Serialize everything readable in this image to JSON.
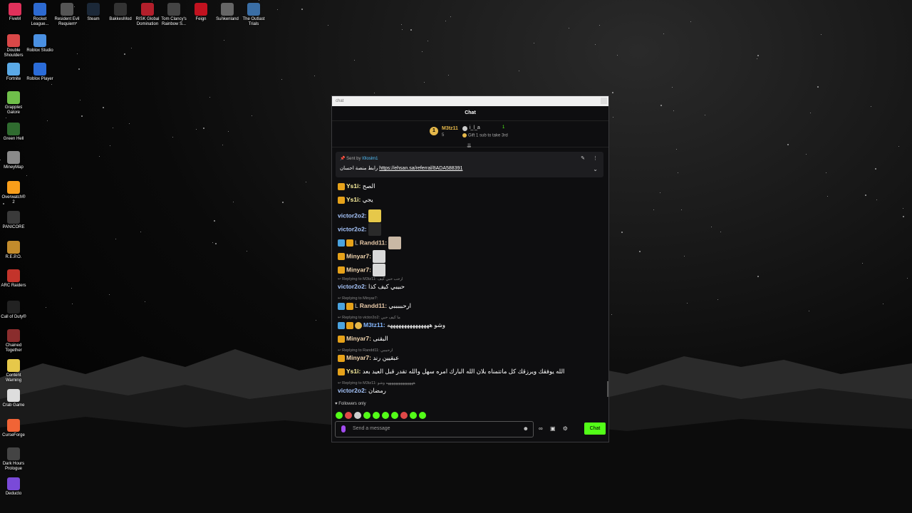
{
  "desktop": {
    "icons": [
      {
        "label": "FiveM",
        "color": "#e0315b"
      },
      {
        "label": "Rocket League...",
        "color": "#2d6ad1"
      },
      {
        "label": "Resident Evil Requiem",
        "color": "#555555"
      },
      {
        "label": "Steam",
        "color": "#1b2838"
      },
      {
        "label": "BakkesMod",
        "color": "#333333"
      },
      {
        "label": "RISK Global Domination",
        "color": "#b21f2b"
      },
      {
        "label": "Tom Clancy's Rainbow S...",
        "color": "#444444"
      },
      {
        "label": "Feign",
        "color": "#c1121f"
      },
      {
        "label": "Sunkenland",
        "color": "#666666"
      },
      {
        "label": "The Outlast Trials",
        "color": "#3a6ea5"
      },
      {
        "label": "Double Shoulders",
        "color": "#d94848"
      },
      {
        "label": "Roblox Studio",
        "color": "#4a90e2"
      },
      {
        "label": "Fortnite",
        "color": "#5aa9e6"
      },
      {
        "label": "Roblox Player",
        "color": "#2b6cd8"
      },
      {
        "label": "Grapples Galore",
        "color": "#6fbf4a"
      },
      {
        "label": "Green Hell",
        "color": "#2f6b2f"
      },
      {
        "label": "MineyMap",
        "color": "#8a8a8a"
      },
      {
        "label": "Overwatch® 2",
        "color": "#f99e1a"
      },
      {
        "label": "PANICORE",
        "color": "#3a3a3a"
      },
      {
        "label": "R.E.P.O.",
        "color": "#c28b2c"
      },
      {
        "label": "ARC Raiders",
        "color": "#c3342b"
      },
      {
        "label": "Call of Duty®",
        "color": "#222222"
      },
      {
        "label": "Chained Together",
        "color": "#8a2d2d"
      },
      {
        "label": "Content Warning",
        "color": "#e6c84a"
      },
      {
        "label": "Crab Game",
        "color": "#dddddd"
      },
      {
        "label": "CurseForge",
        "color": "#f16436"
      },
      {
        "label": "Dark Hours Prologue",
        "color": "#444444"
      },
      {
        "label": "Deducto",
        "color": "#7a4ad8"
      }
    ]
  },
  "window": {
    "title": "chat",
    "header": "Chat"
  },
  "leaderboard": {
    "first_name": "M3tz11",
    "first_count": "5",
    "second_name": "i_l_a",
    "second_count": "1",
    "gift_text": "Gift 1 sub to take 3rd"
  },
  "pinned": {
    "sent_by_label": "Sent by",
    "sent_by_user": "I0loslm1",
    "text_prefix": "رابط منصة احسان",
    "link": "https://ehsan.sa/referral/8ADA588391"
  },
  "messages": [
    {
      "badges": [
        "crown"
      ],
      "user": "Ys1i",
      "color": "#fff3a0",
      "text": "الصح"
    },
    {
      "badges": [
        "crown"
      ],
      "user": "Ys1i",
      "color": "#fff3a0",
      "text": "يجي"
    },
    {
      "badges": [],
      "user": "victor2o2",
      "color": "#a9c8ff",
      "text": "",
      "emote": "#e6c84a"
    },
    {
      "badges": [],
      "user": "victor2o2",
      "color": "#a9c8ff",
      "text": "",
      "emote": "#2a2a2a"
    },
    {
      "badges": [
        "arrow",
        "crown"
      ],
      "prefix": "L",
      "user": "Randd11",
      "color": "#e8c9a8",
      "text": "",
      "emote": "#c9b8a5"
    },
    {
      "badges": [
        "crown"
      ],
      "user": "Minyar7",
      "color": "#f3d7b0",
      "text": "",
      "emote": "#d9d9d9"
    },
    {
      "badges": [
        "crown"
      ],
      "user": "Minyar7",
      "color": "#f3d7b0",
      "text": "",
      "emote": "#d9d9d9"
    },
    {
      "reply": "Replying to M3tz11: ارحب حبي كيف",
      "badges": [],
      "user": "victor2o2",
      "color": "#a9c8ff",
      "text": "حبيبي كيف كذا"
    },
    {
      "reply": "Replying to Minyar7:",
      "badges": [
        "arrow",
        "crown"
      ],
      "prefix": "L",
      "user": "Randd11",
      "color": "#e8c9a8",
      "text": "ارحبببببي"
    },
    {
      "reply": "Replying to victor2o2: ما كيف حبي",
      "badges": [
        "arrow",
        "crown",
        "coin"
      ],
      "user": "M3tz11",
      "color": "#86b8ff",
      "text": "وشو هههههههههههههههه"
    },
    {
      "badges": [
        "crown"
      ],
      "user": "Minyar7",
      "color": "#f3d7b0",
      "text": "البقنى"
    },
    {
      "reply": "Replying to Randd11: ارحبببي",
      "badges": [
        "crown"
      ],
      "user": "Minyar7",
      "color": "#f3d7b0",
      "text": "عبقيين رند"
    },
    {
      "badges": [
        "crown"
      ],
      "user": "Ys1i",
      "color": "#fff3a0",
      "text": "الله يوفقك ويرزقك كل ماتتمناه بلان الله البارك امره سهل والله تقدر قبل العيد بعد"
    },
    {
      "reply": "Replying to M3tz11: هههههههههههههههه وشو",
      "badges": [],
      "user": "victor2o2",
      "color": "#a9c8ff",
      "text": "رمضان"
    }
  ],
  "followers_only": "Followers only",
  "emote_colors": [
    "#53fc18",
    "#e04848",
    "#cccccc",
    "#53fc18",
    "#53fc18",
    "#53fc18",
    "#53fc18",
    "#e04848",
    "#53fc18",
    "#53fc18"
  ],
  "input": {
    "placeholder": "Send a message"
  },
  "send_label": "Chat"
}
